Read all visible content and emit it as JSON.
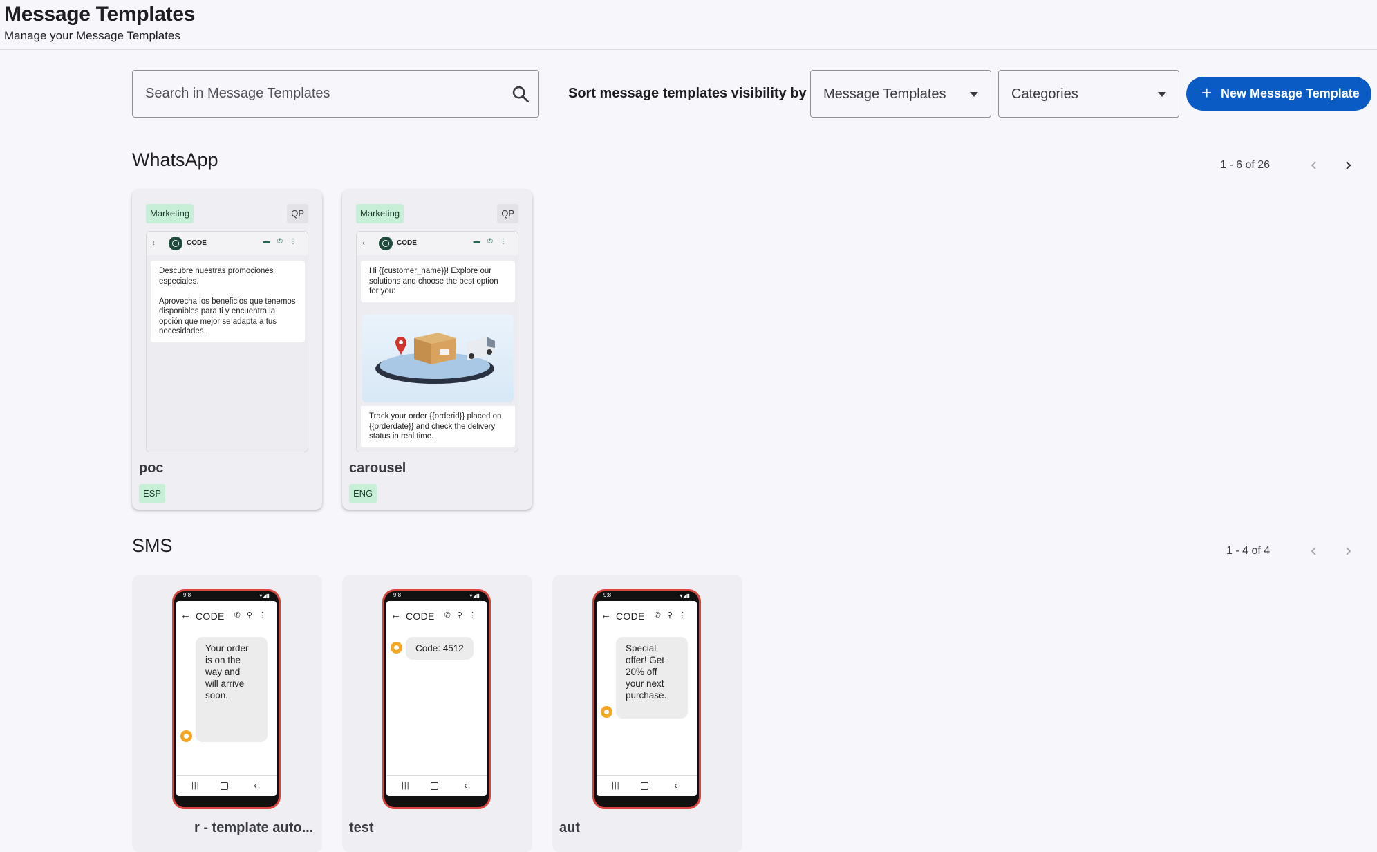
{
  "header": {
    "title": "Message Templates",
    "subtitle": "Manage your Message Templates"
  },
  "toolbar": {
    "search_placeholder": "Search in Message Templates",
    "sort_label": "Sort message templates visibility by",
    "templates_select_value": "Message Templates",
    "categories_select_value": "Categories",
    "new_button_label": "New Message Template",
    "new_button_icon": "plus-icon"
  },
  "colors": {
    "accent": "#0a5bc4",
    "marketing_tag": "#c7efd8",
    "phone_frame": "#d9453c",
    "sms_avatar": "#f5a623"
  },
  "whatsapp": {
    "title": "WhatsApp",
    "pager": "1 - 6 of 26",
    "cards": [
      {
        "category": "Marketing",
        "badge": "QP",
        "contact": "CODE",
        "body": "Descubre nuestras promociones especiales.\n\nAprovecha los beneficios que tenemos disponibles para ti y encuentra la opción que mejor se adapta a tus necesidades.",
        "name": "poc",
        "language": "ESP"
      },
      {
        "category": "Marketing",
        "badge": "QP",
        "contact": "CODE",
        "body": "Hi {{customer_name}}! Explore our solutions and choose the best option for you:",
        "caption": "Track your order {{orderid}} placed on {{orderdate}} and check the delivery status in real time.",
        "name": "carousel",
        "language": "ENG"
      }
    ]
  },
  "sms": {
    "title": "SMS",
    "pager": "1 - 4 of 4",
    "cards": [
      {
        "contact": "CODE",
        "time": "9:8",
        "message": "Your order\nis on the\nway and\nwill arrive\nsoon.",
        "name": "r - template auto..."
      },
      {
        "contact": "CODE",
        "time": "9:8",
        "message": "Code: 4512",
        "name": "test"
      },
      {
        "contact": "CODE",
        "time": "9:8",
        "message": "Special\noffer! Get\n20% off\nyour next\npurchase.",
        "name": "aut"
      }
    ]
  }
}
